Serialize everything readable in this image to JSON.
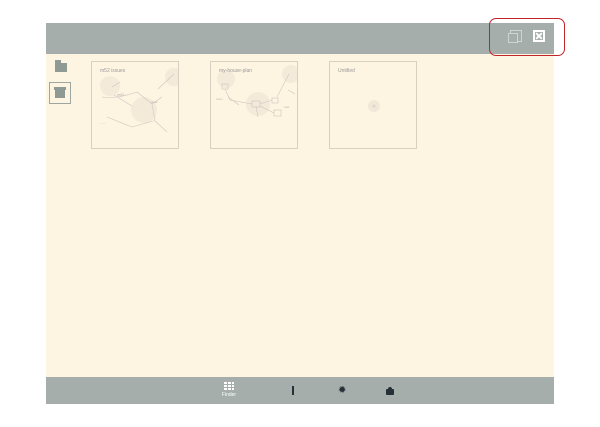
{
  "cards": [
    {
      "title": "m52 issues"
    },
    {
      "title": "my-house-plan"
    },
    {
      "title": "Untitled"
    }
  ],
  "bottom": {
    "finder_label": "Finder"
  },
  "icons": {
    "copy": "copy-icon",
    "close": "close-icon",
    "folder": "folder-icon",
    "archive": "archive-icon",
    "finder": "grid-icon",
    "pen": "pen-icon",
    "gear": "gear-icon",
    "cloud": "cloud-icon"
  },
  "colors": {
    "app_background": "#fdf4e2",
    "toolbar": "#a5aeaa",
    "highlight": "#c2242c",
    "icon_dark": "#253037"
  }
}
